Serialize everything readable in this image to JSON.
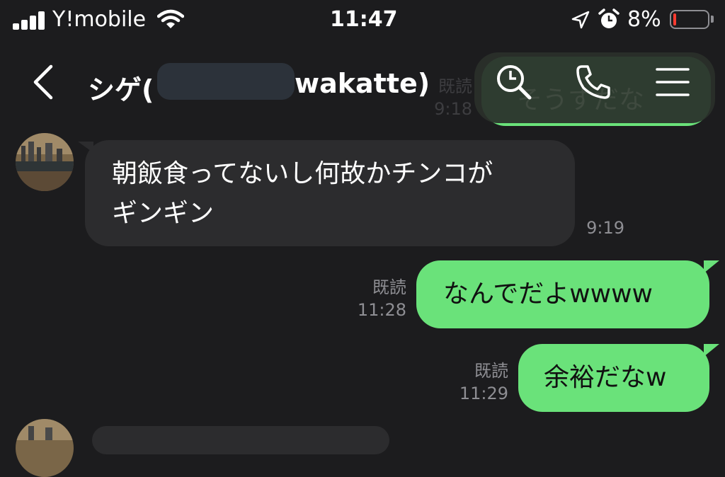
{
  "status_bar": {
    "carrier": "Y!mobile",
    "time": "11:47",
    "battery_percent": "8%",
    "battery_level": 0.08,
    "accent_low_battery": "#ff3b30"
  },
  "header": {
    "name_prefix": "シゲ(",
    "name_suffix": "wakatte)",
    "icons": [
      "back-icon",
      "search-icon",
      "phone-icon",
      "menu-icon"
    ]
  },
  "messages": {
    "prev_outgoing": {
      "text": "そうすだな",
      "read_label": "既読",
      "time": "9:18"
    },
    "m1": {
      "text_line1": "朝飯食ってないし何故かチンコが",
      "text_line2": "ギンギン",
      "time": "9:19"
    },
    "m2": {
      "text": "なんでだよwwww",
      "read_label": "既読",
      "time": "11:28"
    },
    "m3": {
      "text": "余裕だなw",
      "read_label": "既読",
      "time": "11:29"
    }
  },
  "colors": {
    "background": "#1c1c1e",
    "incoming_bubble": "#2c2c2e",
    "outgoing_bubble": "#6ae27a"
  }
}
